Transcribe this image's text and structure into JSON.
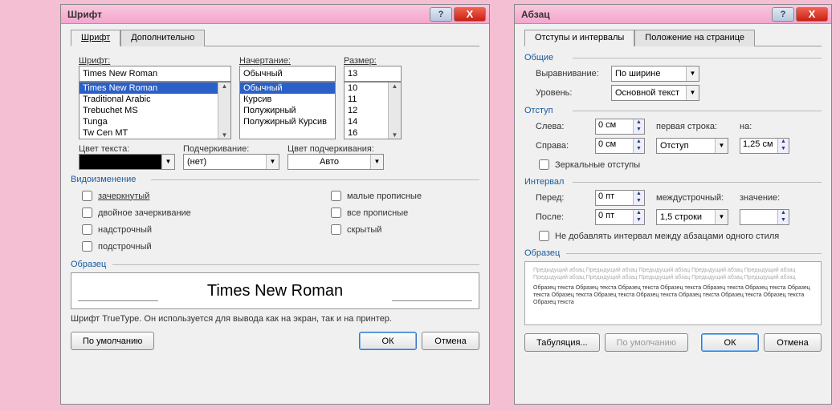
{
  "font_dialog": {
    "title": "Шрифт",
    "tabs": [
      "Шрифт",
      "Дополнительно"
    ],
    "labels": {
      "font": "Шрифт:",
      "style": "Начертание:",
      "size": "Размер:",
      "text_color": "Цвет текста:",
      "underline": "Подчеркивание:",
      "underline_color": "Цвет подчеркивания:",
      "effects": "Видоизменение",
      "sample": "Образец"
    },
    "font_value": "Times New Roman",
    "font_list": [
      "Times New Roman",
      "Traditional Arabic",
      "Trebuchet MS",
      "Tunga",
      "Tw Cen MT"
    ],
    "style_value": "Обычный",
    "style_list": [
      "Обычный",
      "Курсив",
      "Полужирный",
      "Полужирный Курсив"
    ],
    "size_value": "13",
    "size_list": [
      "10",
      "11",
      "12",
      "14",
      "16"
    ],
    "underline_value": "(нет)",
    "underline_color_value": "Авто",
    "effects": {
      "strike": "зачеркнутый",
      "dstrike": "двойное зачеркивание",
      "super": "надстрочный",
      "sub": "подстрочный",
      "smallcaps": "малые прописные",
      "allcaps": "все прописные",
      "hidden": "скрытый"
    },
    "sample_text": "Times New Roman",
    "hint": "Шрифт TrueType. Он используется для вывода как на экран, так и на принтер.",
    "buttons": {
      "default": "По умолчанию",
      "ok": "ОК",
      "cancel": "Отмена"
    }
  },
  "para_dialog": {
    "title": "Абзац",
    "tabs": [
      "Отступы и интервалы",
      "Положение на странице"
    ],
    "groups": {
      "general": "Общие",
      "indent": "Отступ",
      "spacing": "Интервал",
      "sample": "Образец"
    },
    "labels": {
      "align": "Выравнивание:",
      "level": "Уровень:",
      "left": "Слева:",
      "right": "Справа:",
      "firstline": "первая строка:",
      "by": "на:",
      "mirror": "Зеркальные отступы",
      "before": "Перед:",
      "after": "После:",
      "line": "междустрочный:",
      "value": "значение:",
      "noadd": "Не добавлять интервал между абзацами одного стиля"
    },
    "align_value": "По ширине",
    "level_value": "Основной текст",
    "left_value": "0 см",
    "right_value": "0 см",
    "firstline_value": "Отступ",
    "by_value": "1,25 см",
    "before_value": "0 пт",
    "after_value": "0 пт",
    "line_value": "1,5 строки",
    "linevalue_value": "",
    "sample_faint": "Предыдущий абзац Предыдущий абзац Предыдущий абзац Предыдущий абзац Предыдущий абзац Предыдущий абзац Предыдущий абзац Предыдущий абзац Предыдущий абзац Предыдущий абзац",
    "sample_body": "Образец текста Образец текста Образец текста Образец текста Образец текста Образец текста Образец текста Образец текста Образец текста Образец текста Образец текста Образец текста Образец текста Образец текста",
    "buttons": {
      "tabs": "Табуляция...",
      "default": "По умолчанию",
      "ok": "ОК",
      "cancel": "Отмена"
    }
  }
}
